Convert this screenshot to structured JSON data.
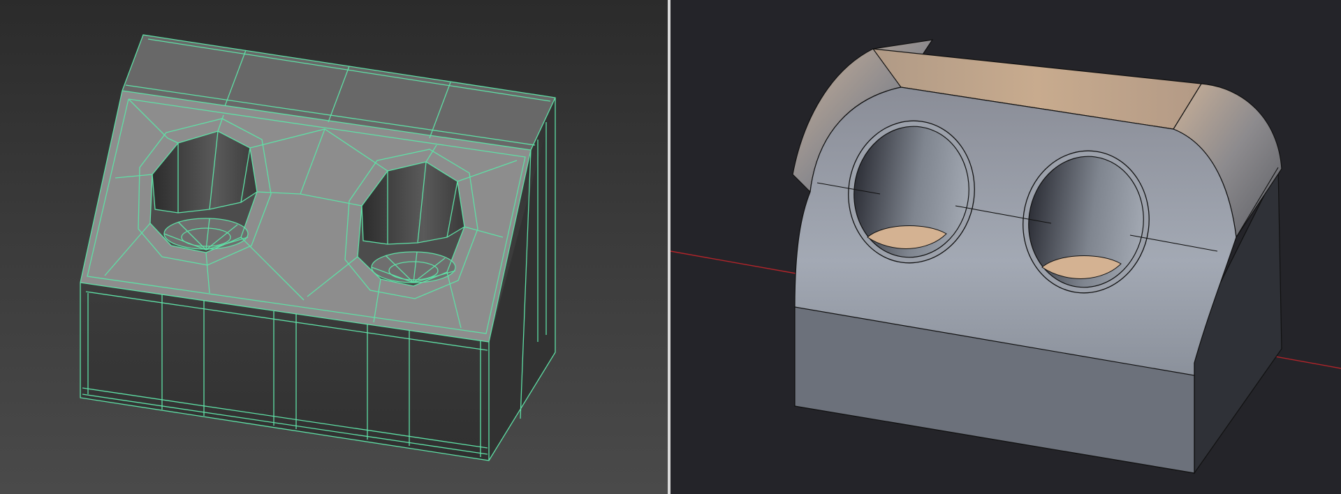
{
  "viewports": {
    "left": {
      "display_mode": "wireframe-on-shaded",
      "background": "#3a3a3a",
      "wire_color": "#5fe0a6",
      "shaded_color": "#8c8c8c"
    },
    "right": {
      "display_mode": "shaded-with-edges",
      "background": "#242429",
      "surface_color": "#8e929b",
      "cap_color": "#c7a888",
      "axis_color": "#b1242a"
    }
  },
  "divider": {
    "color": "#d9d9d9"
  }
}
